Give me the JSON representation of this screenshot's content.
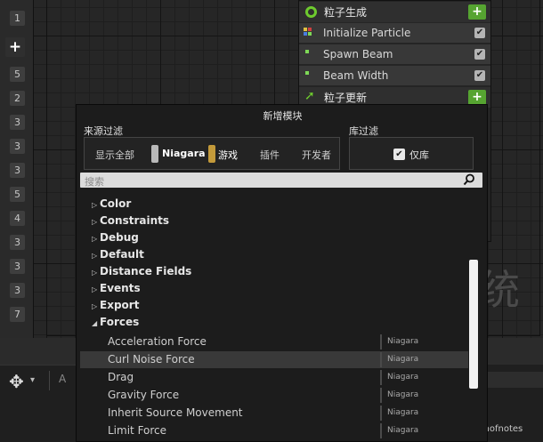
{
  "left_column": {
    "add_label": "+",
    "numbers": [
      "1",
      "5",
      "2",
      "3",
      "3",
      "3",
      "5",
      "4",
      "3",
      "3",
      "3",
      "7"
    ]
  },
  "emitter": {
    "spawn_section": "粒子生成",
    "spawn_modules": [
      "Initialize Particle",
      "Spawn Beam",
      "Beam Width"
    ],
    "update_section": "粒子更新",
    "add_label": "+",
    "check_glyph": "✔"
  },
  "popup": {
    "title": "新增模块",
    "source_filter_label": "来源过滤",
    "library_filter_label": "库过滤",
    "sources": [
      {
        "label": "显示全部",
        "swatch": ""
      },
      {
        "label": "Niagara",
        "swatch": "#b9b9b9"
      },
      {
        "label": "游戏",
        "swatch": "#c39a3a"
      },
      {
        "label": "插件",
        "swatch": ""
      },
      {
        "label": "开发者",
        "swatch": ""
      }
    ],
    "library_only_label": "仅库",
    "check_glyph": "✔",
    "search_placeholder": "搜索",
    "categories": [
      {
        "label": "Color",
        "expanded": false
      },
      {
        "label": "Constraints",
        "expanded": false
      },
      {
        "label": "Debug",
        "expanded": false
      },
      {
        "label": "Default",
        "expanded": false
      },
      {
        "label": "Distance Fields",
        "expanded": false
      },
      {
        "label": "Events",
        "expanded": false
      },
      {
        "label": "Export",
        "expanded": false
      },
      {
        "label": "Forces",
        "expanded": true
      }
    ],
    "force_items": [
      {
        "label": "Acceleration Force",
        "source": "Niagara",
        "selected": false
      },
      {
        "label": "Curl Noise Force",
        "source": "Niagara",
        "selected": true
      },
      {
        "label": "Drag",
        "source": "Niagara",
        "selected": false
      },
      {
        "label": "Gravity Force",
        "source": "Niagara",
        "selected": false
      },
      {
        "label": "Inherit Source Movement",
        "source": "Niagara",
        "selected": false
      },
      {
        "label": "Limit Force",
        "source": "Niagara",
        "selected": false
      }
    ],
    "scroll_position": 0.25
  },
  "toolbar": {
    "move_icon": "✥",
    "caret": "▾",
    "text_tool_glyph": "A"
  },
  "watermark": "CSDN @Growthofnotes",
  "graph_glyph": "统",
  "colors": {
    "accent_green": "#56a431",
    "graph_bg": "#262626",
    "popup_bg": "#1c1c1c"
  }
}
